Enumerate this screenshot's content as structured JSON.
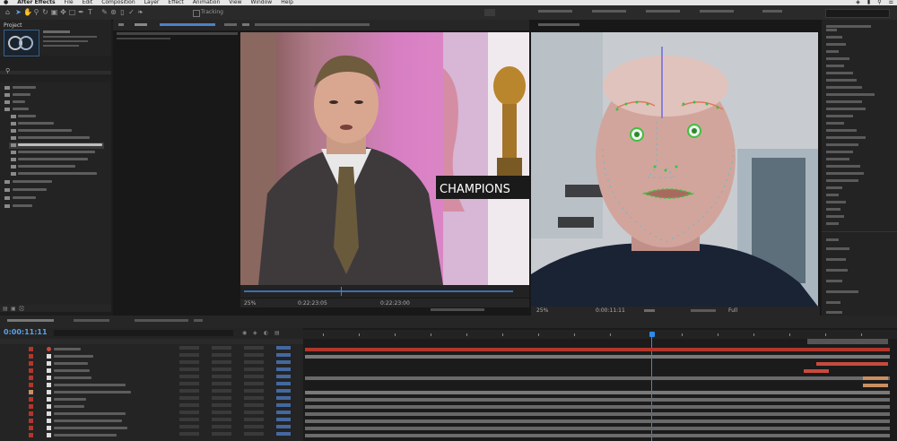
{
  "app": {
    "name": "After Effects",
    "menu": [
      "File",
      "Edit",
      "Composition",
      "Layer",
      "Effect",
      "Animation",
      "View",
      "Window",
      "Help"
    ]
  },
  "toolbar": {
    "workspace_label": "Tracking",
    "icons": [
      "home-icon",
      "selection-tool-icon",
      "hand-tool-icon",
      "zoom-tool-icon",
      "rotate-tool-icon",
      "camera-tool-icon",
      "pan-behind-icon",
      "rectangle-tool-icon",
      "pen-tool-icon",
      "type-tool-icon",
      "brush-tool-icon",
      "clone-stamp-icon",
      "eraser-icon",
      "roto-brush-icon",
      "puppet-pin-icon"
    ]
  },
  "project": {
    "tab_label": "Project"
  },
  "viewers": {
    "left": {
      "overlay_text": "CHAMPIONS",
      "zoom": "25%",
      "timecode": "0:22:23:05",
      "timecode2": "0:22:23:00"
    },
    "right": {
      "zoom": "25%",
      "timecode": "0:00:11:11",
      "view_label": "Full"
    }
  },
  "timeline": {
    "timecode": "0:00:11:11"
  },
  "colors": {
    "accent_blue": "#2d8ceb",
    "track_red": "#b2362c",
    "track_salmon": "#c84a3c",
    "track_tan": "#c98f61",
    "playhead": "#2d8ceb"
  }
}
